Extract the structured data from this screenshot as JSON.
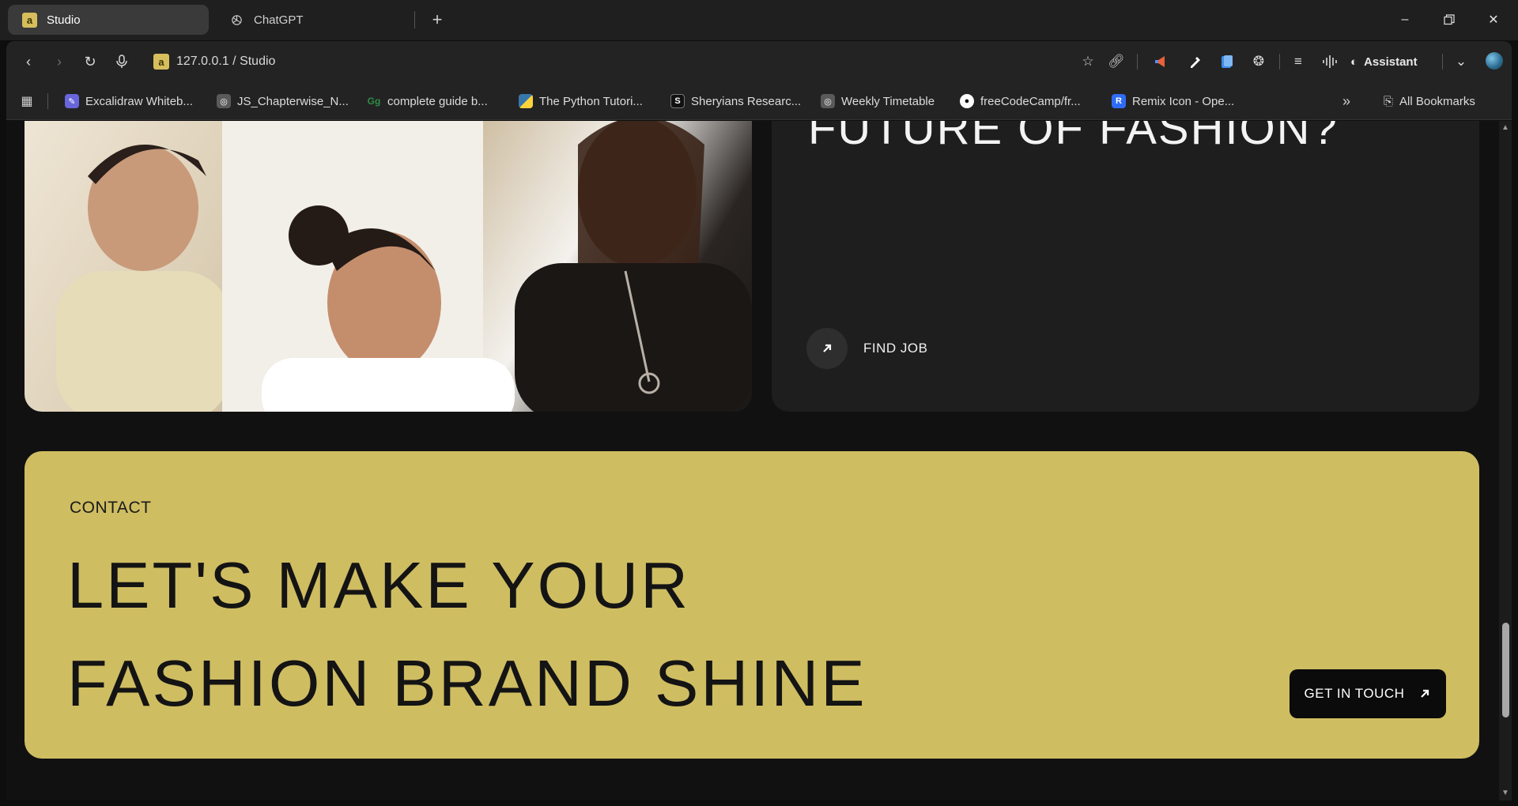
{
  "tabs": [
    {
      "label": "Studio",
      "favicon": "a"
    },
    {
      "label": "ChatGPT"
    }
  ],
  "address_bar": {
    "url": "127.0.0.1 / Studio",
    "favicon": "a"
  },
  "toolbar": {
    "assistant_label": "Assistant"
  },
  "bookmarks": {
    "items": [
      {
        "label": "Excalidraw Whiteb...",
        "icon": "excalidraw-icon",
        "color": "#6965db"
      },
      {
        "label": "JS_Chapterwise_N...",
        "icon": "globe-icon",
        "color": "#5a5a5a"
      },
      {
        "label": "complete guide b...",
        "icon": "geeks-icon",
        "color": "#2f8d46"
      },
      {
        "label": "The Python Tutori...",
        "icon": "python-icon",
        "color": "#3776ab"
      },
      {
        "label": "Sheryians Researc...",
        "icon": "sheryians-icon",
        "color": "#111111"
      },
      {
        "label": "Weekly Timetable",
        "icon": "globe-icon",
        "color": "#5a5a5a"
      },
      {
        "label": "freeCodeCamp/fr...",
        "icon": "github-icon",
        "color": "#ffffff"
      },
      {
        "label": "Remix Icon - Ope...",
        "icon": "remix-icon",
        "color": "#2f6cf6"
      }
    ],
    "all_bookmarks_label": "All Bookmarks"
  },
  "page": {
    "job_card": {
      "title": "FUTURE OF FASHION?",
      "cta_label": "FIND JOB"
    },
    "contact": {
      "eyebrow": "CONTACT",
      "headline_line1": "LET'S MAKE YOUR",
      "headline_line2": "FASHION BRAND SHINE",
      "button_label": "GET IN TOUCH"
    }
  },
  "colors": {
    "accent": "#cfbd62",
    "page_bg": "#111111",
    "card_bg": "#1e1e1e"
  }
}
